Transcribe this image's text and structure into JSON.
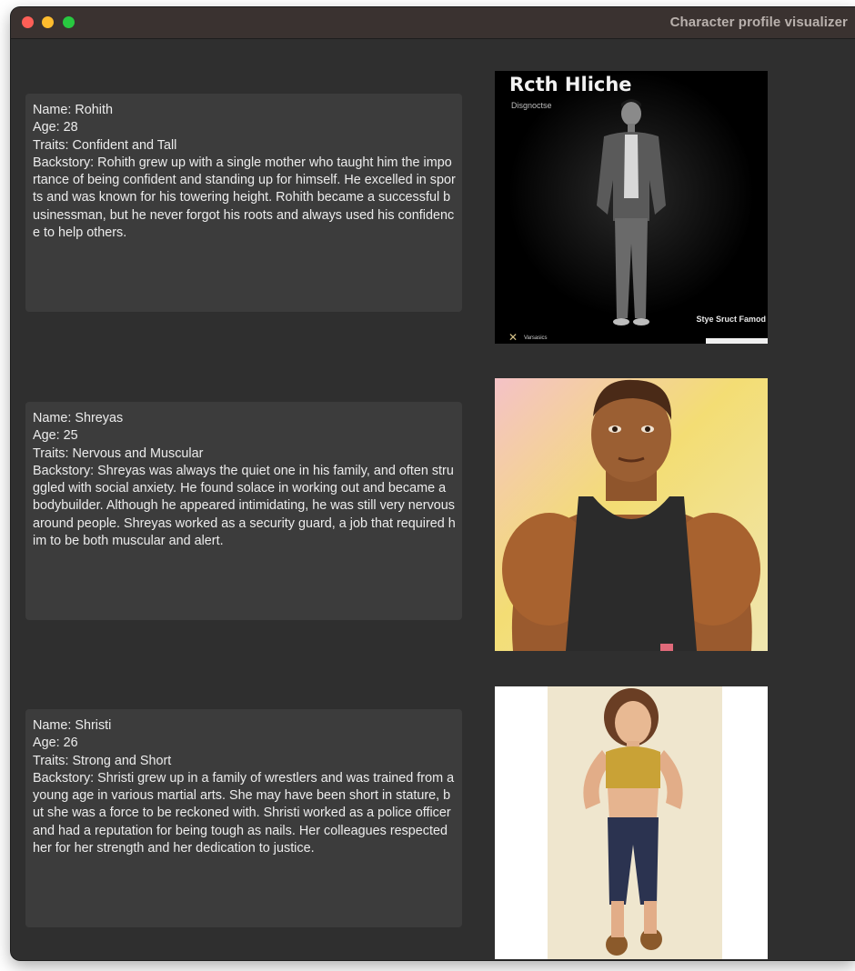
{
  "window": {
    "title": "Character profile visualizer"
  },
  "characters": [
    {
      "name_line": "Name: Rohith",
      "age_line": "Age: 28",
      "traits_line": "Traits: Confident and Tall",
      "backstory_line": "Backstory: Rohith grew up with a single mother who taught him the importance of being confident and standing up for himself. He excelled in sports and was known for his towering height. Rohith became a successful businessman, but he never forgot his roots and always used his confidence to help others.",
      "image": {
        "title_text": "Rcth Hliche",
        "subtitle_text": "Disgnoctse",
        "corner_text": "Stye Sruct Famod",
        "footer_text": "Varsasics"
      }
    },
    {
      "name_line": "Name: Shreyas",
      "age_line": "Age: 25",
      "traits_line": "Traits: Nervous and Muscular",
      "backstory_line": "Backstory: Shreyas was always the quiet one in his family, and often struggled with social anxiety. He found solace in working out and became a bodybuilder. Although he appeared intimidating, he was still very nervous around people. Shreyas worked as a security guard, a job that required him to be both muscular and alert."
    },
    {
      "name_line": "Name: Shristi",
      "age_line": "Age: 26",
      "traits_line": "Traits: Strong and Short",
      "backstory_line": "Backstory: Shristi grew up in a family of wrestlers and was trained from a young age in various martial arts. She may have been short in stature, but she was a force to be reckoned with. Shristi worked as a police officer and had a reputation for being tough as nails. Her colleagues respected her for her strength and her dedication to justice."
    }
  ]
}
